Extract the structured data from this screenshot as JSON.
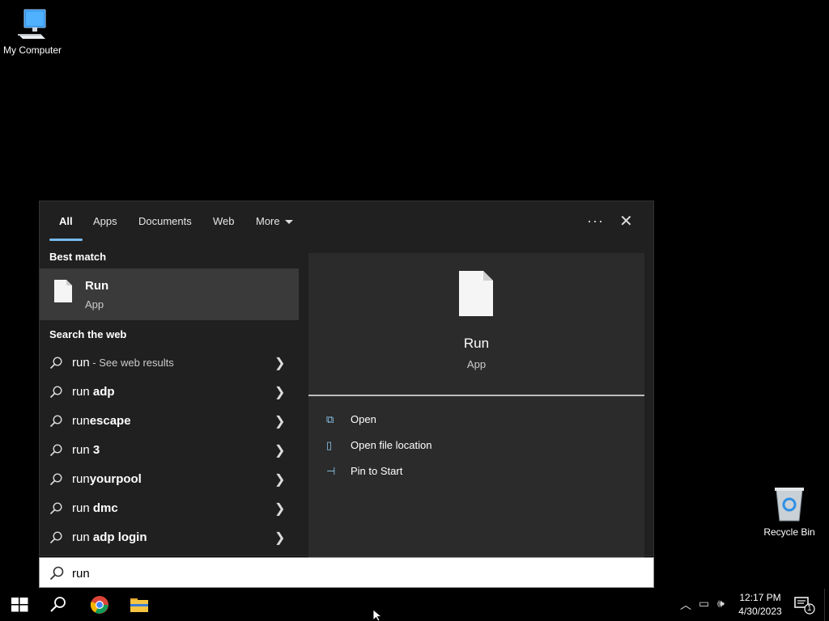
{
  "desktop": {
    "my_computer_label": "My Computer",
    "recycle_bin_label": "Recycle Bin"
  },
  "search": {
    "tabs": [
      "All",
      "Apps",
      "Documents",
      "Web",
      "More"
    ],
    "active_tab": "All",
    "best_match_heading": "Best match",
    "best_match": {
      "name": "Run",
      "type": "App"
    },
    "web_heading": "Search the web",
    "web_items": [
      {
        "prefix": "run",
        "bold": "",
        "hint": " - See web results"
      },
      {
        "prefix": "run ",
        "bold": "adp",
        "hint": ""
      },
      {
        "prefix": "run",
        "bold": "escape",
        "hint": ""
      },
      {
        "prefix": "run ",
        "bold": "3",
        "hint": ""
      },
      {
        "prefix": "run",
        "bold": "yourpool",
        "hint": ""
      },
      {
        "prefix": "run ",
        "bold": "dmc",
        "hint": ""
      },
      {
        "prefix": "run ",
        "bold": "adp login",
        "hint": ""
      }
    ],
    "preview": {
      "name": "Run",
      "type": "App"
    },
    "actions": [
      "Open",
      "Open file location",
      "Pin to Start"
    ],
    "query": "run"
  },
  "taskbar": {
    "time": "12:17 PM",
    "date": "4/30/2023",
    "notification_count": "1"
  },
  "colors": {
    "accent": "#76b9ed",
    "flyout_bg": "#202020",
    "preview_bg": "#2b2b2b",
    "selected_bg": "#3a3a3a"
  }
}
